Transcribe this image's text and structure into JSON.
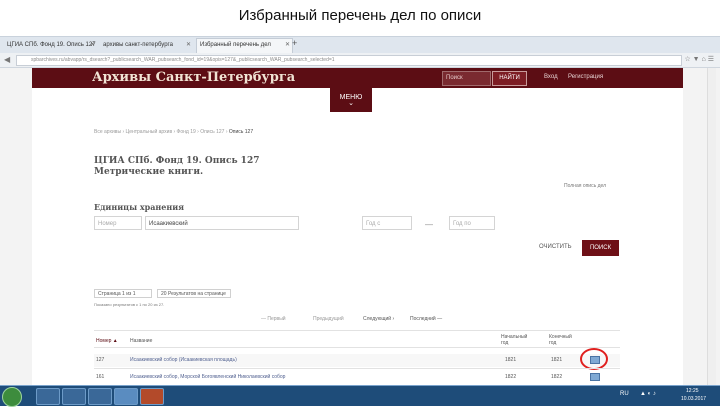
{
  "slide": {
    "title": "Избранный перечень дел по описи"
  },
  "browser": {
    "tabs": [
      {
        "label": "ЦГИА СПб. Фонд 19. Опись 127"
      },
      {
        "label": "архивы санкт-петербурга"
      },
      {
        "label": "Избранный перечень дел"
      }
    ],
    "new_tab": "+",
    "url": "spbarchives.ru/abvapp/rs_dsearch?_publicsearch_WAR_pubsearch_fond_id=19&opis=127&_publicsearch_WAR_pubsearch_selected=1",
    "nav_back": "◀",
    "toolbar_icons": "☆ ▼ ⌂ ☰"
  },
  "site": {
    "title": "Архивы Санкт-Петербурга",
    "search_placeholder": "Поиск",
    "search_button": "НАЙТИ",
    "login": "Вход",
    "register": "Регистрация",
    "menu_label": "МЕНЮ",
    "menu_chevron": "⌄"
  },
  "breadcrumb": {
    "path": "Все архивы › Центральный архив › Фонд 19 › Опись 127 › ",
    "current": "Опись 127"
  },
  "page": {
    "heading1": "ЦГИА СПб. Фонд 19. Опись 127",
    "heading2": "Метрические книги.",
    "full_list_link": "Полная опись дел",
    "units_title": "Единицы хранения"
  },
  "filters": {
    "number_placeholder": "Номер",
    "title_value": "Исаакиевский",
    "year_from_placeholder": "Год с",
    "dash": "—",
    "year_to_placeholder": "Год по",
    "clear": "ОЧИСТИТЬ",
    "find": "ПОИСК"
  },
  "results": {
    "page_select": "Страница 1 из 1",
    "per_page_select": "20 Результатов на странице",
    "shown_text": "Показано результатов с 1 по 20 из 27.",
    "pager": {
      "first": "— Первый",
      "prev": "Предыдущий",
      "next": "Следующий ›",
      "last": "Последний —"
    },
    "columns": {
      "number": "Номер ▲",
      "title": "Название",
      "start_year": "Начальный год",
      "end_year": "Конечный год"
    },
    "rows": [
      {
        "number": "127",
        "title": "Исаакиевский собор (Исаакиевская площадь)",
        "start": "1821",
        "end": "1821"
      },
      {
        "number": "161",
        "title": "Исаакиевский собор, Морской Богоявленский Николаевский собор",
        "start": "1822",
        "end": "1822"
      }
    ],
    "icon_name": "table-icon"
  },
  "taskbar": {
    "lang": "RU",
    "tray": "▲ ◐ ♪",
    "time": "12:25",
    "date": "10.03.2017"
  },
  "colors": {
    "brand": "#5c0d14",
    "accent_red": "#e0201f",
    "taskbar": "#1e4c79"
  }
}
